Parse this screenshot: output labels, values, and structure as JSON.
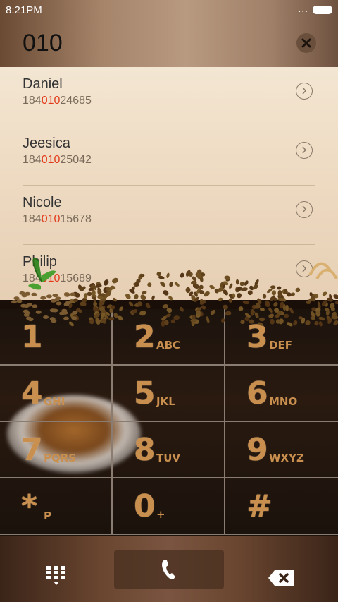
{
  "status_bar": {
    "time": "8:21PM",
    "signal": "..."
  },
  "dialer": {
    "input_value": "010"
  },
  "contacts": [
    {
      "name": "Daniel",
      "number_prefix": "184",
      "number_match": "010",
      "number_suffix": "24685"
    },
    {
      "name": "Jeesica",
      "number_prefix": "184",
      "number_match": "010",
      "number_suffix": "25042"
    },
    {
      "name": "Nicole",
      "number_prefix": "184",
      "number_match": "010",
      "number_suffix": "15678"
    },
    {
      "name": "Philip",
      "number_prefix": "184",
      "number_match": "010",
      "number_suffix": "15689"
    }
  ],
  "keypad": {
    "keys": [
      {
        "digit": "1",
        "letters": ""
      },
      {
        "digit": "2",
        "letters": "ABC"
      },
      {
        "digit": "3",
        "letters": "DEF"
      },
      {
        "digit": "4",
        "letters": "GHI"
      },
      {
        "digit": "5",
        "letters": "JKL"
      },
      {
        "digit": "6",
        "letters": "MNO"
      },
      {
        "digit": "7",
        "letters": "PQRS"
      },
      {
        "digit": "8",
        "letters": "TUV"
      },
      {
        "digit": "9",
        "letters": "WXYZ"
      },
      {
        "digit": "*",
        "letters": "P"
      },
      {
        "digit": "0",
        "letters": "+"
      },
      {
        "digit": "#",
        "letters": ""
      }
    ]
  },
  "bottom_bar": {
    "keypad_icon": "keypad-grid-icon",
    "call_icon": "phone-icon",
    "backspace_icon": "backspace-icon"
  },
  "colors": {
    "highlight": "#e23a1a",
    "key_text": "#c98f4e"
  }
}
